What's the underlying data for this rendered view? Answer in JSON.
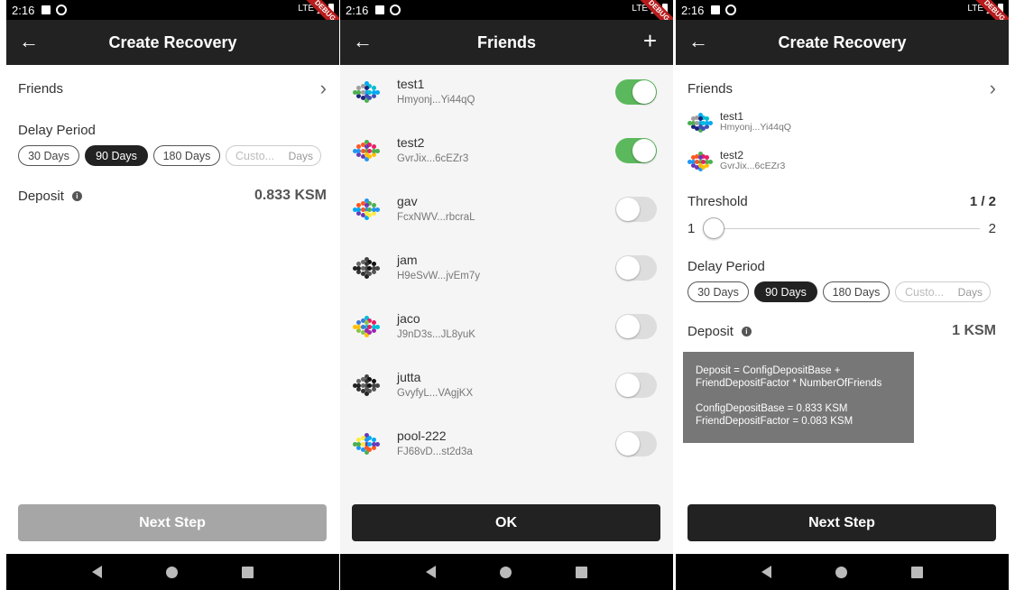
{
  "status": {
    "time": "2:16",
    "network": "LTE",
    "debug_label": "DEBUG"
  },
  "create_recovery": {
    "title": "Create Recovery",
    "friends_label": "Friends",
    "delay_label": "Delay Period",
    "delay_options": [
      "30 Days",
      "90 Days",
      "180 Days"
    ],
    "delay_selected": "90 Days",
    "custom_placeholder": "Custo...",
    "custom_suffix": "Days",
    "deposit_label": "Deposit",
    "deposit_value_initial": "0.833 KSM",
    "next_label": "Next Step"
  },
  "friends_page": {
    "title": "Friends",
    "ok_label": "OK",
    "items": [
      {
        "name": "test1",
        "address": "Hmyonj...Yi44qQ",
        "enabled": true
      },
      {
        "name": "test2",
        "address": "GvrJix...6cEZr3",
        "enabled": true
      },
      {
        "name": "gav",
        "address": "FcxNWV...rbcraL",
        "enabled": false
      },
      {
        "name": "jam",
        "address": "H9eSvW...jvEm7y",
        "enabled": false
      },
      {
        "name": "jaco",
        "address": "J9nD3s...JL8yuK",
        "enabled": false
      },
      {
        "name": "jutta",
        "address": "GvyfyL...VAgjKX",
        "enabled": false
      },
      {
        "name": "pool-222",
        "address": "FJ68vD...st2d3a",
        "enabled": false
      }
    ]
  },
  "recovery_filled": {
    "selected_friends": [
      {
        "name": "test1",
        "address": "Hmyonj...Yi44qQ"
      },
      {
        "name": "test2",
        "address": "GvrJix...6cEZr3"
      }
    ],
    "threshold_label": "Threshold",
    "threshold_value": "1 / 2",
    "threshold_current": 1,
    "slider_min": "1",
    "slider_max": "2",
    "deposit_value": "1 KSM",
    "tooltip": {
      "line1": "Deposit = ConfigDepositBase +",
      "line2": "FriendDepositFactor * NumberOfFriends",
      "line3": "ConfigDepositBase = 0.833 KSM",
      "line4": "FriendDepositFactor = 0.083 KSM"
    }
  },
  "colors": {
    "toggle_on": "#5cb85c",
    "appbar": "#222222",
    "button_disabled": "#a6a6a6"
  }
}
